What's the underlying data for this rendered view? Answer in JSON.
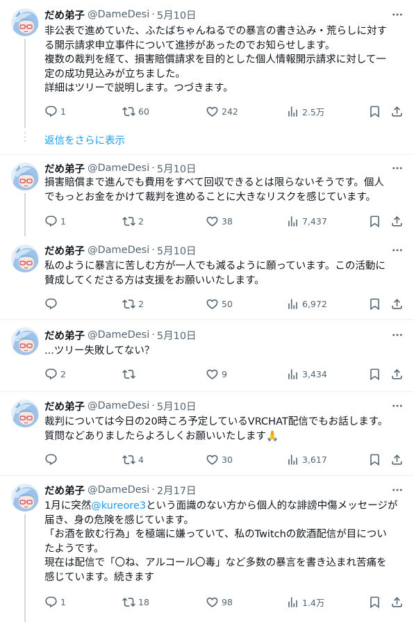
{
  "author": {
    "name": "だめ弟子",
    "handle": "@DameDesi"
  },
  "show_more_replies": "返信をさらに表示",
  "tweets": [
    {
      "date": "5月10日",
      "lines": [
        "非公表で進めていた、ふたばちゃんねるでの暴言の書き込み・荒らしに対す",
        "る開示請求申立事件について進捗があったのでお知らせします。",
        "複数の裁判を経て、損害賠償請求を目的とした個人情報開示請求に対して一",
        "定の成功見込みが立ちました。",
        "詳細はツリーで説明します。つづきます。"
      ],
      "replies": "1",
      "retweets": "60",
      "likes": "242",
      "views": "2.5万"
    },
    {
      "date": "5月10日",
      "lines": [
        "損害賠償まで進んでも費用をすべて回収できるとは限らないそうです。個人",
        "でもっとお金をかけて裁判を進めることに大きなリスクを感じています。"
      ],
      "replies": "1",
      "retweets": "2",
      "likes": "38",
      "views": "7,437"
    },
    {
      "date": "5月10日",
      "lines": [
        "私のように暴言に苦しむ方が一人でも減るように願っています。この活動に",
        "賛成してくださる方は支援をお願いいたします。"
      ],
      "replies": "",
      "retweets": "2",
      "likes": "50",
      "views": "6,972"
    },
    {
      "date": "5月10日",
      "lines": [
        "...ツリー失敗してない？"
      ],
      "replies": "2",
      "retweets": "",
      "likes": "9",
      "views": "3,434"
    },
    {
      "date": "5月10日",
      "lines": [
        "裁判については今日の20時ころ予定しているVRCHAT配信でもお話します。",
        "質問などありましたらよろしくお願いいたします🙏"
      ],
      "replies": "",
      "retweets": "4",
      "likes": "30",
      "views": "3,617"
    },
    {
      "date": "2月17日",
      "line1_prefix": "1月に突然",
      "mention": "@kureore3",
      "line1_suffix": "という面識のない方から個人的な誹謗中傷メッセージが",
      "lines": [
        "届き、身の危険を感じています。",
        "「お酒を飲む行為」を極端に嫌っていて、私のTwitchの飲酒配信が目につい",
        "たようです。",
        "現在は配信で「〇ね、アルコール〇毒」など多数の暴言を書き込まれ苦痛を",
        "感じています。続きます"
      ],
      "replies": "1",
      "retweets": "18",
      "likes": "98",
      "views": "1.4万"
    }
  ],
  "colors": {
    "accent": "#1d9bf0",
    "text": "#0f1419",
    "muted": "#536471",
    "border": "#eff3f4"
  },
  "icons": [
    "avatar",
    "more-icon",
    "reply-icon",
    "retweet-icon",
    "like-icon",
    "views-icon",
    "bookmark-icon",
    "share-icon"
  ]
}
